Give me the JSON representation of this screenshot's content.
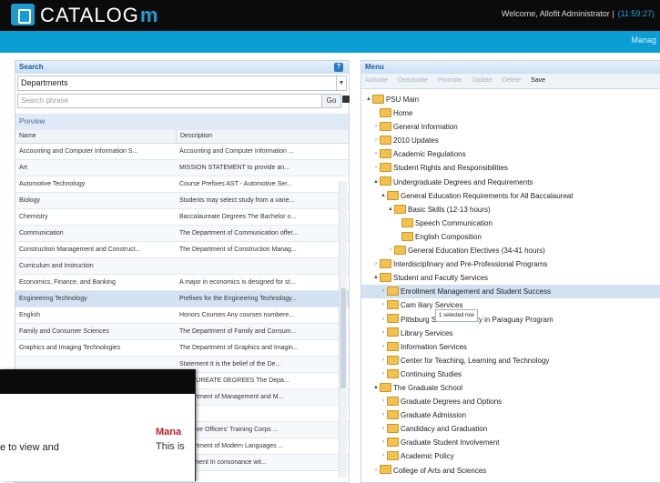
{
  "header": {
    "brand_prefix": "CATALOG",
    "brand_suffix": "m",
    "welcome": "Welcome, Allofit Administrator |",
    "time": "(11:59:27)"
  },
  "nav": {
    "right_link": "Manag"
  },
  "search": {
    "title": "Search",
    "help": "?",
    "dropdown_value": "Departments",
    "placeholder": "Search phrase",
    "go_label": "Go",
    "preview_label": "Preview",
    "col_name": "Name",
    "col_description": "Description"
  },
  "rows": [
    {
      "name": "Accounting and Computer Information S...",
      "desc": "Accounting and Computer Information ..."
    },
    {
      "name": "Art",
      "desc": "MISSION STATEMENT    to provide an..."
    },
    {
      "name": "Automotive Technology",
      "desc": "Course Prefixes AST - Automotive Ser..."
    },
    {
      "name": "Biology",
      "desc": "Students may select study from a varie..."
    },
    {
      "name": "Chemistry",
      "desc": "Baccalaureate Degrees  The Bachelor o..."
    },
    {
      "name": "Communication",
      "desc": "The Department of Communication offer..."
    },
    {
      "name": "Construction Management and Construct...",
      "desc": "The Department of Construction Manag..."
    },
    {
      "name": "Curriculum and Instruction",
      "desc": ""
    },
    {
      "name": "Economics, Finance, and Banking",
      "desc": "A major in economics is designed for st..."
    },
    {
      "name": "Engineering Technology",
      "desc": "Prefixes for the Engineering Technology..."
    },
    {
      "name": "English",
      "desc": "Honors Courses  Any courses numbere..."
    },
    {
      "name": "Family and Consumer Sciences",
      "desc": "The Department of Family and Consum..."
    },
    {
      "name": "Graphics and Imaging Technologies",
      "desc": "The Department of Graphics and Imagin..."
    },
    {
      "name": "",
      "desc": "Statement It is the belief of the De..."
    },
    {
      "name": "",
      "desc": "CALAUREATE DEGREES The Depa..."
    },
    {
      "name": "",
      "desc": "Department of Management and M..."
    },
    {
      "name": "",
      "desc": ""
    },
    {
      "name": "",
      "desc": "Reserve Officers' Training Corps ..."
    },
    {
      "name": "",
      "desc": "Department of Modern Languages ..."
    },
    {
      "name": "",
      "desc": "Statement  In consonance wit..."
    }
  ],
  "menu": {
    "title": "Menu",
    "toolbar": [
      "Activate",
      "Deactivate",
      "Promote",
      "Update",
      "Delete",
      "Save"
    ],
    "drag_tip": "1 selected row",
    "items": [
      {
        "label": "PSU Main",
        "depth": 0,
        "exp": "▲",
        "folder": true
      },
      {
        "label": "Home",
        "depth": 1,
        "exp": "",
        "folder": true
      },
      {
        "label": "General Information",
        "depth": 1,
        "exp": "›",
        "folder": true
      },
      {
        "label": "2010 Updates",
        "depth": 1,
        "exp": "›",
        "folder": true
      },
      {
        "label": "Academic Regulations",
        "depth": 1,
        "exp": "›",
        "folder": true
      },
      {
        "label": "Student Rights and Responsibilities",
        "depth": 1,
        "exp": "›",
        "folder": true
      },
      {
        "label": "Undergraduate Degrees and Requirements",
        "depth": 1,
        "exp": "▲",
        "folder": true
      },
      {
        "label": "General Education Requirements for All Baccalaureat",
        "depth": 2,
        "exp": "▲",
        "folder": true
      },
      {
        "label": "Basic Skills (12-13 hours)",
        "depth": 3,
        "exp": "▲",
        "folder": true
      },
      {
        "label": "Speech Communication",
        "depth": 4,
        "exp": "",
        "folder": true
      },
      {
        "label": "English Composition",
        "depth": 4,
        "exp": "",
        "folder": true
      },
      {
        "label": "General Education Electives (34-41 hours)",
        "depth": 3,
        "exp": "›",
        "folder": true
      },
      {
        "label": "Interdisciplinary and Pre-Professional Programs",
        "depth": 1,
        "exp": "›",
        "folder": true
      },
      {
        "label": "Student and Faculty Services",
        "depth": 1,
        "exp": "▲",
        "folder": true
      },
      {
        "label": "Enrollment Management and Student Success",
        "depth": 2,
        "exp": "›",
        "folder": true,
        "selected": true
      },
      {
        "label": "Cam             iliary Services",
        "depth": 2,
        "exp": "›",
        "folder": true
      },
      {
        "label": "Pittsburg State University in Paraguay Program",
        "depth": 2,
        "exp": "›",
        "folder": true
      },
      {
        "label": "Library Services",
        "depth": 2,
        "exp": "›",
        "folder": true
      },
      {
        "label": "Information Services",
        "depth": 2,
        "exp": "›",
        "folder": true
      },
      {
        "label": "Center for Teaching, Learning and Technology",
        "depth": 2,
        "exp": "›",
        "folder": true
      },
      {
        "label": "Continuing Studies",
        "depth": 2,
        "exp": "›",
        "folder": true
      },
      {
        "label": "The Graduate School",
        "depth": 1,
        "exp": "▲",
        "folder": true
      },
      {
        "label": "Graduate Degrees and Options",
        "depth": 2,
        "exp": "›",
        "folder": true
      },
      {
        "label": "Graduate Admission",
        "depth": 2,
        "exp": "›",
        "folder": true
      },
      {
        "label": "Candidacy and Graduation",
        "depth": 2,
        "exp": "›",
        "folder": true
      },
      {
        "label": "Graduate Student Involvement",
        "depth": 2,
        "exp": "›",
        "folder": true
      },
      {
        "label": "Academic Policy",
        "depth": 2,
        "exp": "›",
        "folder": true
      },
      {
        "label": "College of Arts and Sciences",
        "depth": 1,
        "exp": "›",
        "folder": true
      }
    ]
  },
  "overlay": {
    "text": "e to view and",
    "mana": "Mana",
    "thisis": "This is"
  }
}
